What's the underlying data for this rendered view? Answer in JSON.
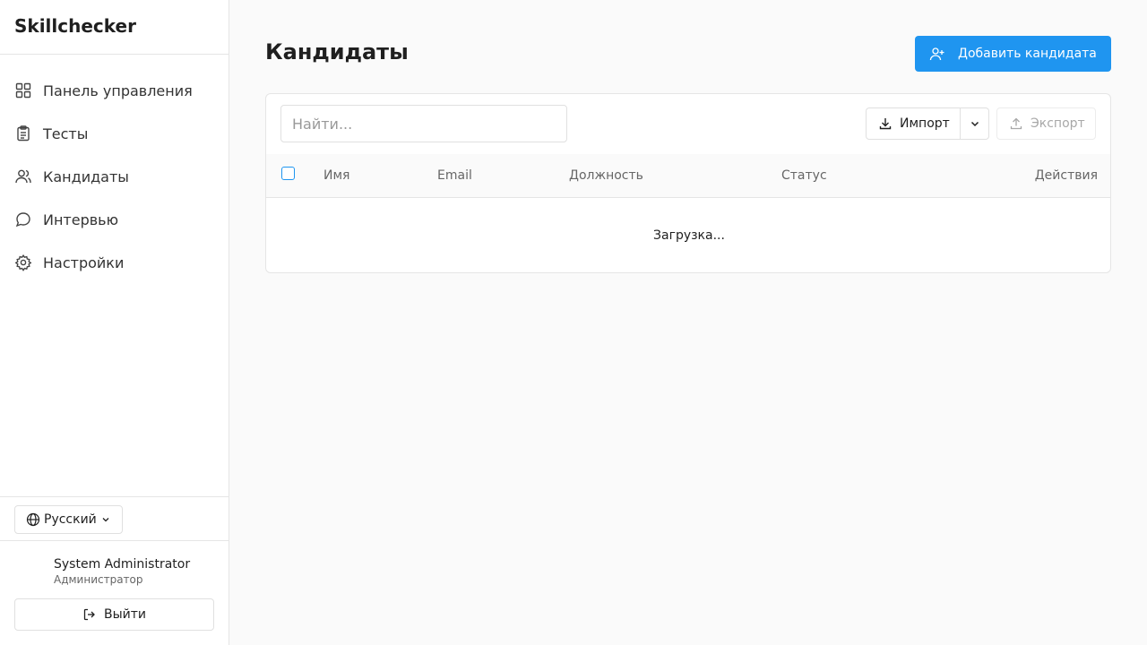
{
  "app": {
    "brand": "Skillchecker"
  },
  "sidebar": {
    "items": [
      {
        "label": "Панель управления",
        "icon": "dashboard-icon"
      },
      {
        "label": "Тесты",
        "icon": "clipboard-icon"
      },
      {
        "label": "Кандидаты",
        "icon": "users-icon"
      },
      {
        "label": "Интервью",
        "icon": "chat-icon"
      },
      {
        "label": "Настройки",
        "icon": "gear-icon"
      }
    ],
    "language": {
      "label": "Русский",
      "icon": "globe-icon"
    },
    "user": {
      "name": "System Administrator",
      "role": "Администратор"
    },
    "logout_label": "Выйти"
  },
  "main": {
    "title": "Кандидаты",
    "add_button_label": "Добавить кандидата",
    "search": {
      "placeholder": "Найти...",
      "value": ""
    },
    "import_label": "Импорт",
    "export_label": "Экспорт",
    "table": {
      "columns": [
        "Имя",
        "Email",
        "Должность",
        "Статус",
        "Действия"
      ],
      "loading_text": "Загрузка..."
    }
  },
  "colors": {
    "accent": "#1f95f0",
    "background": "#fafafa"
  }
}
